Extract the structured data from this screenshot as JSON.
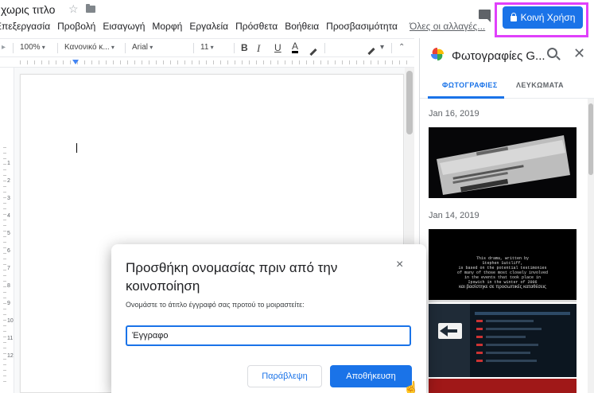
{
  "title_bar": {
    "doc_title": "χωρις τιτλο",
    "star_icon": "star-outline-icon",
    "folder_icon": "folder-icon"
  },
  "menu": {
    "items": [
      "Επεξεργασία",
      "Προβολή",
      "Εισαγωγή",
      "Μορφή",
      "Εργαλεία",
      "Πρόσθετα",
      "Βοήθεια",
      "Προσβασιμότητα"
    ],
    "changes_link": "Όλες οι αλλαγές..."
  },
  "share": {
    "label": "Κοινή Χρήση",
    "icon": "lock-icon",
    "color": "#1a73e8",
    "highlight_color": "#e040fb"
  },
  "toolbar": {
    "zoom": "100%",
    "style": "Κανονικό κ...",
    "font": "Arial",
    "font_size": "11",
    "bold": "B",
    "italic": "I",
    "underline": "U",
    "text_color": "A"
  },
  "ruler": {
    "vertical_numbers": [
      "1",
      "2",
      "3",
      "4",
      "5",
      "6",
      "7",
      "8",
      "9",
      "10",
      "11",
      "12"
    ]
  },
  "panel": {
    "title": "Φωτογραφίες G...",
    "tabs": [
      "ΦΩΤΟΓΡΑΦΙΕΣ",
      "ΛΕΥΚΩΜΑΤΑ"
    ],
    "active_tab": 0,
    "groups": [
      {
        "date": "Jan 16, 2019"
      },
      {
        "date": "Jan 14, 2019"
      }
    ],
    "photo_text": {
      "p2_line1": "This drama, written by",
      "p2_line2": "Stephen Sutcliff,",
      "p2_line3": "is based on the potential testimonies",
      "p2_line4": "of many of those most closely involved",
      "p2_line5": "in the events that took place in",
      "p2_line6": "Ipswich in the winter of 2006",
      "p2_line7": "και βασίστηκε σε προσωπικές καταθέσεις"
    }
  },
  "dialog": {
    "title": "Προσθήκη ονομασίας πριν από την κοινοποίηση",
    "description": "Ονομάστε το άτιτλο έγγραφό σας προτού το μοιραστείτε:",
    "input_value": "Έγγραφο",
    "skip_label": "Παράβλεψη",
    "save_label": "Αποθήκευση",
    "close_symbol": "×"
  }
}
